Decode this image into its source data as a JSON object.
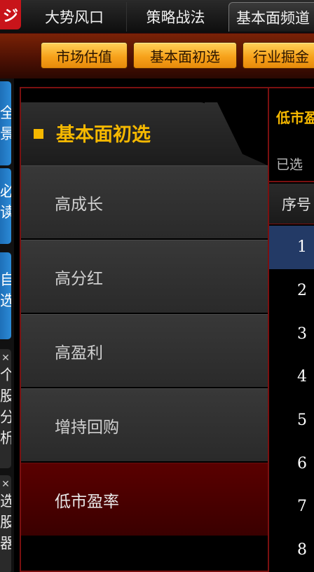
{
  "logo": {
    "glyph": "ジ"
  },
  "top_tabs": [
    {
      "label": "大势风口"
    },
    {
      "label": "策略战法"
    },
    {
      "label": "基本面频道"
    }
  ],
  "sub_buttons": [
    {
      "label": "市场估值"
    },
    {
      "label": "基本面初选"
    },
    {
      "label": "行业掘金"
    }
  ],
  "side_tabs": [
    {
      "text": "全景"
    },
    {
      "text": "必读"
    },
    {
      "text": "自选"
    },
    {
      "text": "个股分析"
    },
    {
      "text": "选股器"
    }
  ],
  "menu": {
    "title": "基本面初选",
    "items": [
      {
        "label": "高成长"
      },
      {
        "label": "高分红"
      },
      {
        "label": "高盈利"
      },
      {
        "label": "增持回购"
      },
      {
        "label": "低市盈率"
      }
    ],
    "active_index": 4
  },
  "content": {
    "title": "低市盈",
    "subtitle": "已选",
    "column_seq": "序号",
    "rows": [
      "1",
      "2",
      "3",
      "4",
      "5",
      "6",
      "7",
      "8"
    ],
    "selected_row": 0
  },
  "colors": {
    "accent_yellow": "#f5b800",
    "button_orange": "#f7a21b",
    "border_red": "#7a1010",
    "active_red": "#4a0000",
    "side_blue": "#1e6fb8",
    "selection_blue": "#233a66"
  }
}
